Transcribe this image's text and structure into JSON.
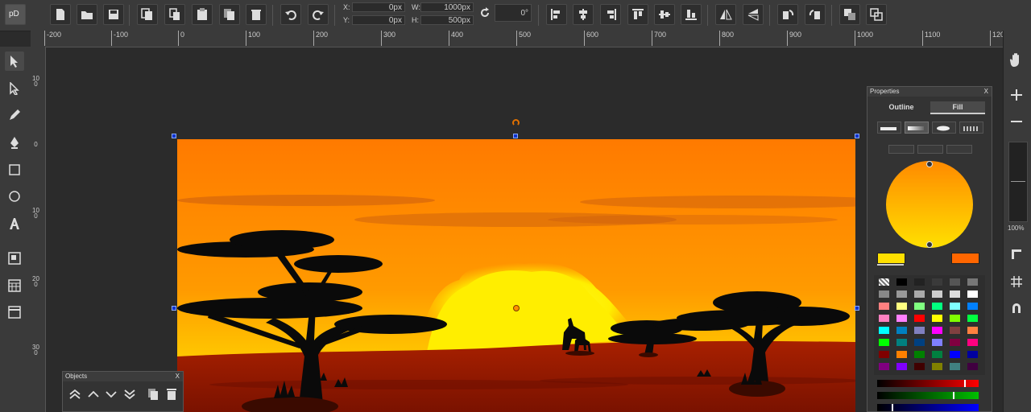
{
  "app": {
    "logo": "pD"
  },
  "toolbar": {
    "x_label": "X:",
    "x_value": "0px",
    "y_label": "Y:",
    "y_value": "0px",
    "w_label": "W:",
    "w_value": "1000px",
    "h_label": "H:",
    "h_value": "500px",
    "rotation_value": "0°"
  },
  "ruler": {
    "h_ticks": [
      "-200",
      "-100",
      "0",
      "100",
      "200",
      "300",
      "400",
      "500",
      "600",
      "700",
      "800",
      "900",
      "1000",
      "1100",
      "120"
    ],
    "v_ticks": [
      "100",
      "0",
      "100",
      "200",
      "300"
    ]
  },
  "zoom": {
    "level": "100%"
  },
  "properties": {
    "title": "Properties",
    "close": "X",
    "tabs": [
      "Outline",
      "Fill"
    ],
    "active_tab": "Fill",
    "gradient_color_top": "#ff8a00",
    "gradient_color_bottom": "#ffe000",
    "stop_color_1": "#ffe000",
    "stop_color_2": "#ff6600"
  },
  "objects": {
    "title": "Objects",
    "close": "X"
  }
}
